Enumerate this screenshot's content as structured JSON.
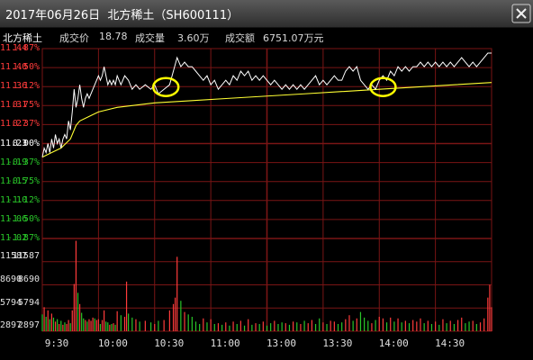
{
  "window": {
    "title": "2017年06月26日  北方稀土（SH600111）"
  },
  "info_bar": {
    "stock_name": "北方稀土",
    "price_label": "成交价",
    "price_value": "18.78",
    "volume_label": "成交量",
    "volume_value": "3.60万",
    "amount_label": "成交额",
    "amount_value": "6751.07万元"
  },
  "colors": {
    "up": "#ff3b3b",
    "down": "#29c529",
    "neutral": "#ffffff",
    "price_line": "#ffffff",
    "avg_line": "#ffff33",
    "grid": "#7a1515",
    "highlight_circle": "#ffff00"
  },
  "price_axis": [
    {
      "label": "11.44",
      "type": "up"
    },
    {
      "label": "11.40",
      "type": "up"
    },
    {
      "label": "11.36",
      "type": "up"
    },
    {
      "label": "11.31",
      "type": "up"
    },
    {
      "label": "11.27",
      "type": "up"
    },
    {
      "label": "11.23",
      "type": "neutral"
    },
    {
      "label": "11.19",
      "type": "down"
    },
    {
      "label": "11.15",
      "type": "down"
    },
    {
      "label": "11.10",
      "type": "down"
    },
    {
      "label": "11.06",
      "type": "down"
    },
    {
      "label": "11.02",
      "type": "down"
    }
  ],
  "percent_axis": [
    {
      "label": "1.87%",
      "type": "up"
    },
    {
      "label": "1.50%",
      "type": "up"
    },
    {
      "label": "1.12%",
      "type": "up"
    },
    {
      "label": "0.75%",
      "type": "up"
    },
    {
      "label": "0.37%",
      "type": "up"
    },
    {
      "label": "0.00%",
      "type": "neutral"
    },
    {
      "label": "-0.37%",
      "type": "down"
    },
    {
      "label": "-0.75%",
      "type": "down"
    },
    {
      "label": "-1.12%",
      "type": "down"
    },
    {
      "label": "-1.50%",
      "type": "down"
    },
    {
      "label": "-1.87%",
      "type": "down"
    }
  ],
  "volume_axis": [
    "11587",
    "8690",
    "5794",
    "2897"
  ],
  "time_axis": [
    "9:30",
    "10:00",
    "10:30",
    "11:00",
    "13:00",
    "13:30",
    "14:00",
    "14:30"
  ],
  "chart_data": {
    "type": "line",
    "ylim": [
      11.02,
      11.44
    ],
    "volume_ylim": [
      0,
      11587
    ],
    "session_minutes": 240,
    "price_series": [
      [
        0,
        11.2
      ],
      [
        1,
        11.22
      ],
      [
        2,
        11.21
      ],
      [
        3,
        11.23
      ],
      [
        4,
        11.21
      ],
      [
        5,
        11.24
      ],
      [
        6,
        11.22
      ],
      [
        7,
        11.25
      ],
      [
        8,
        11.23
      ],
      [
        9,
        11.24
      ],
      [
        10,
        11.22
      ],
      [
        11,
        11.24
      ],
      [
        12,
        11.25
      ],
      [
        13,
        11.24
      ],
      [
        14,
        11.28
      ],
      [
        15,
        11.26
      ],
      [
        16,
        11.3
      ],
      [
        17,
        11.35
      ],
      [
        18,
        11.31
      ],
      [
        19,
        11.33
      ],
      [
        20,
        11.36
      ],
      [
        21,
        11.33
      ],
      [
        22,
        11.31
      ],
      [
        23,
        11.33
      ],
      [
        24,
        11.34
      ],
      [
        25,
        11.33
      ],
      [
        26,
        11.34
      ],
      [
        27,
        11.35
      ],
      [
        28,
        11.36
      ],
      [
        29,
        11.37
      ],
      [
        30,
        11.38
      ],
      [
        31,
        11.37
      ],
      [
        32,
        11.38
      ],
      [
        33,
        11.4
      ],
      [
        34,
        11.38
      ],
      [
        35,
        11.36
      ],
      [
        36,
        11.37
      ],
      [
        37,
        11.36
      ],
      [
        38,
        11.37
      ],
      [
        39,
        11.36
      ],
      [
        40,
        11.38
      ],
      [
        42,
        11.36
      ],
      [
        44,
        11.38
      ],
      [
        46,
        11.37
      ],
      [
        48,
        11.35
      ],
      [
        50,
        11.36
      ],
      [
        52,
        11.35
      ],
      [
        55,
        11.36
      ],
      [
        58,
        11.35
      ],
      [
        60,
        11.36
      ],
      [
        62,
        11.34
      ],
      [
        65,
        11.35
      ],
      [
        68,
        11.36
      ],
      [
        70,
        11.39
      ],
      [
        72,
        11.42
      ],
      [
        74,
        11.4
      ],
      [
        76,
        11.41
      ],
      [
        78,
        11.4
      ],
      [
        80,
        11.4
      ],
      [
        82,
        11.39
      ],
      [
        84,
        11.38
      ],
      [
        86,
        11.37
      ],
      [
        88,
        11.38
      ],
      [
        90,
        11.36
      ],
      [
        92,
        11.37
      ],
      [
        94,
        11.35
      ],
      [
        96,
        11.36
      ],
      [
        98,
        11.37
      ],
      [
        100,
        11.36
      ],
      [
        102,
        11.38
      ],
      [
        104,
        11.37
      ],
      [
        106,
        11.39
      ],
      [
        108,
        11.38
      ],
      [
        110,
        11.39
      ],
      [
        112,
        11.37
      ],
      [
        114,
        11.38
      ],
      [
        116,
        11.37
      ],
      [
        118,
        11.38
      ],
      [
        120,
        11.37
      ],
      [
        122,
        11.36
      ],
      [
        124,
        11.37
      ],
      [
        126,
        11.36
      ],
      [
        128,
        11.35
      ],
      [
        130,
        11.36
      ],
      [
        132,
        11.35
      ],
      [
        134,
        11.36
      ],
      [
        136,
        11.35
      ],
      [
        138,
        11.36
      ],
      [
        140,
        11.35
      ],
      [
        142,
        11.36
      ],
      [
        144,
        11.37
      ],
      [
        146,
        11.38
      ],
      [
        148,
        11.36
      ],
      [
        150,
        11.37
      ],
      [
        152,
        11.36
      ],
      [
        154,
        11.37
      ],
      [
        156,
        11.38
      ],
      [
        158,
        11.37
      ],
      [
        160,
        11.37
      ],
      [
        162,
        11.39
      ],
      [
        164,
        11.4
      ],
      [
        166,
        11.39
      ],
      [
        168,
        11.4
      ],
      [
        170,
        11.37
      ],
      [
        172,
        11.36
      ],
      [
        174,
        11.35
      ],
      [
        176,
        11.36
      ],
      [
        178,
        11.35
      ],
      [
        180,
        11.37
      ],
      [
        182,
        11.38
      ],
      [
        184,
        11.37
      ],
      [
        186,
        11.39
      ],
      [
        188,
        11.38
      ],
      [
        190,
        11.4
      ],
      [
        192,
        11.39
      ],
      [
        194,
        11.4
      ],
      [
        196,
        11.39
      ],
      [
        198,
        11.4
      ],
      [
        200,
        11.4
      ],
      [
        202,
        11.41
      ],
      [
        204,
        11.4
      ],
      [
        206,
        11.41
      ],
      [
        208,
        11.4
      ],
      [
        210,
        11.41
      ],
      [
        212,
        11.4
      ],
      [
        214,
        11.41
      ],
      [
        216,
        11.4
      ],
      [
        218,
        11.41
      ],
      [
        220,
        11.4
      ],
      [
        222,
        11.41
      ],
      [
        224,
        11.42
      ],
      [
        226,
        11.41
      ],
      [
        228,
        11.4
      ],
      [
        230,
        11.41
      ],
      [
        232,
        11.4
      ],
      [
        234,
        11.41
      ],
      [
        236,
        11.42
      ],
      [
        238,
        11.43
      ],
      [
        240,
        11.43
      ]
    ],
    "avg_series": [
      [
        0,
        11.2
      ],
      [
        5,
        11.21
      ],
      [
        10,
        11.22
      ],
      [
        15,
        11.24
      ],
      [
        18,
        11.27
      ],
      [
        20,
        11.28
      ],
      [
        25,
        11.29
      ],
      [
        30,
        11.3
      ],
      [
        40,
        11.31
      ],
      [
        50,
        11.315
      ],
      [
        60,
        11.32
      ],
      [
        80,
        11.325
      ],
      [
        100,
        11.33
      ],
      [
        120,
        11.335
      ],
      [
        140,
        11.34
      ],
      [
        160,
        11.345
      ],
      [
        180,
        11.35
      ],
      [
        200,
        11.355
      ],
      [
        220,
        11.36
      ],
      [
        240,
        11.365
      ]
    ],
    "volume_bars": [
      [
        0,
        2100,
        "d"
      ],
      [
        1,
        3000,
        "u"
      ],
      [
        2,
        1800,
        "d"
      ],
      [
        3,
        2600,
        "u"
      ],
      [
        4,
        1500,
        "d"
      ],
      [
        5,
        2200,
        "u"
      ],
      [
        6,
        1700,
        "d"
      ],
      [
        7,
        1200,
        "u"
      ],
      [
        8,
        1500,
        "d"
      ],
      [
        9,
        900,
        "u"
      ],
      [
        10,
        1300,
        "d"
      ],
      [
        11,
        800,
        "u"
      ],
      [
        12,
        1100,
        "d"
      ],
      [
        13,
        900,
        "u"
      ],
      [
        14,
        1400,
        "u"
      ],
      [
        15,
        1000,
        "d"
      ],
      [
        16,
        2600,
        "u"
      ],
      [
        17,
        5900,
        "u"
      ],
      [
        18,
        11300,
        "u"
      ],
      [
        19,
        4800,
        "d"
      ],
      [
        20,
        3400,
        "u"
      ],
      [
        21,
        2300,
        "d"
      ],
      [
        22,
        1600,
        "d"
      ],
      [
        23,
        1400,
        "u"
      ],
      [
        24,
        1200,
        "d"
      ],
      [
        25,
        1500,
        "u"
      ],
      [
        26,
        1300,
        "u"
      ],
      [
        27,
        1700,
        "u"
      ],
      [
        28,
        1600,
        "d"
      ],
      [
        29,
        1400,
        "u"
      ],
      [
        30,
        1500,
        "u"
      ],
      [
        31,
        900,
        "d"
      ],
      [
        32,
        1400,
        "u"
      ],
      [
        33,
        2600,
        "u"
      ],
      [
        34,
        1200,
        "d"
      ],
      [
        35,
        1100,
        "d"
      ],
      [
        36,
        800,
        "u"
      ],
      [
        37,
        900,
        "d"
      ],
      [
        38,
        1000,
        "u"
      ],
      [
        39,
        800,
        "d"
      ],
      [
        40,
        2500,
        "u"
      ],
      [
        42,
        2000,
        "d"
      ],
      [
        44,
        1800,
        "u"
      ],
      [
        45,
        6200,
        "u"
      ],
      [
        46,
        2200,
        "d"
      ],
      [
        48,
        1700,
        "d"
      ],
      [
        50,
        1500,
        "u"
      ],
      [
        52,
        1200,
        "d"
      ],
      [
        55,
        1300,
        "u"
      ],
      [
        58,
        1100,
        "d"
      ],
      [
        60,
        900,
        "u"
      ],
      [
        62,
        1300,
        "d"
      ],
      [
        65,
        1400,
        "u"
      ],
      [
        68,
        2600,
        "u"
      ],
      [
        70,
        3400,
        "u"
      ],
      [
        71,
        4200,
        "u"
      ],
      [
        72,
        9300,
        "u"
      ],
      [
        74,
        3800,
        "d"
      ],
      [
        76,
        2400,
        "u"
      ],
      [
        78,
        2100,
        "d"
      ],
      [
        80,
        1800,
        "d"
      ],
      [
        82,
        1200,
        "d"
      ],
      [
        84,
        900,
        "d"
      ],
      [
        86,
        1600,
        "u"
      ],
      [
        88,
        1100,
        "d"
      ],
      [
        90,
        1500,
        "u"
      ],
      [
        92,
        900,
        "d"
      ],
      [
        94,
        1000,
        "u"
      ],
      [
        96,
        800,
        "d"
      ],
      [
        98,
        1100,
        "u"
      ],
      [
        100,
        700,
        "d"
      ],
      [
        102,
        1200,
        "u"
      ],
      [
        104,
        900,
        "d"
      ],
      [
        106,
        1300,
        "u"
      ],
      [
        108,
        700,
        "d"
      ],
      [
        110,
        1500,
        "u"
      ],
      [
        112,
        800,
        "d"
      ],
      [
        114,
        1000,
        "u"
      ],
      [
        116,
        900,
        "d"
      ],
      [
        118,
        1200,
        "u"
      ],
      [
        120,
        700,
        "d"
      ],
      [
        122,
        1000,
        "d"
      ],
      [
        124,
        1300,
        "u"
      ],
      [
        126,
        900,
        "d"
      ],
      [
        128,
        1100,
        "d"
      ],
      [
        130,
        1000,
        "u"
      ],
      [
        132,
        800,
        "d"
      ],
      [
        134,
        1200,
        "u"
      ],
      [
        136,
        1100,
        "d"
      ],
      [
        138,
        900,
        "u"
      ],
      [
        140,
        1300,
        "d"
      ],
      [
        142,
        1000,
        "u"
      ],
      [
        144,
        1400,
        "u"
      ],
      [
        146,
        900,
        "d"
      ],
      [
        148,
        1600,
        "d"
      ],
      [
        150,
        1100,
        "u"
      ],
      [
        152,
        900,
        "d"
      ],
      [
        154,
        1300,
        "u"
      ],
      [
        156,
        1200,
        "u"
      ],
      [
        158,
        900,
        "d"
      ],
      [
        160,
        1100,
        "d"
      ],
      [
        162,
        1500,
        "u"
      ],
      [
        164,
        2000,
        "u"
      ],
      [
        166,
        1300,
        "d"
      ],
      [
        168,
        1600,
        "u"
      ],
      [
        170,
        2400,
        "d"
      ],
      [
        172,
        1700,
        "d"
      ],
      [
        174,
        1300,
        "d"
      ],
      [
        176,
        1000,
        "u"
      ],
      [
        178,
        1400,
        "d"
      ],
      [
        180,
        1800,
        "u"
      ],
      [
        182,
        1600,
        "u"
      ],
      [
        184,
        1100,
        "d"
      ],
      [
        186,
        1700,
        "u"
      ],
      [
        188,
        1200,
        "d"
      ],
      [
        190,
        1600,
        "u"
      ],
      [
        192,
        1100,
        "d"
      ],
      [
        194,
        1300,
        "u"
      ],
      [
        196,
        1000,
        "d"
      ],
      [
        198,
        1400,
        "u"
      ],
      [
        200,
        1200,
        "u"
      ],
      [
        202,
        1600,
        "u"
      ],
      [
        204,
        1000,
        "d"
      ],
      [
        206,
        1300,
        "u"
      ],
      [
        208,
        900,
        "d"
      ],
      [
        210,
        1200,
        "u"
      ],
      [
        212,
        800,
        "d"
      ],
      [
        214,
        1500,
        "u"
      ],
      [
        216,
        1000,
        "d"
      ],
      [
        218,
        1300,
        "u"
      ],
      [
        220,
        900,
        "d"
      ],
      [
        222,
        1400,
        "u"
      ],
      [
        224,
        1700,
        "u"
      ],
      [
        226,
        1000,
        "d"
      ],
      [
        228,
        1200,
        "d"
      ],
      [
        230,
        1300,
        "u"
      ],
      [
        232,
        900,
        "d"
      ],
      [
        234,
        1100,
        "u"
      ],
      [
        236,
        1600,
        "u"
      ],
      [
        238,
        4200,
        "u"
      ],
      [
        239,
        5800,
        "u"
      ],
      [
        240,
        3000,
        "u"
      ]
    ],
    "highlights": [
      {
        "minute": 66,
        "price": 11.355
      },
      {
        "minute": 182,
        "price": 11.355
      }
    ]
  }
}
